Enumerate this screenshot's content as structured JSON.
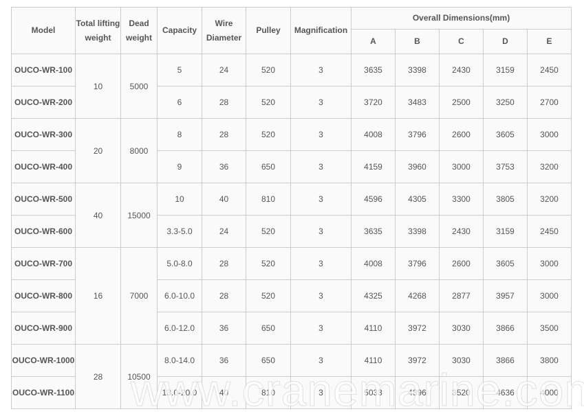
{
  "table": {
    "headers": {
      "model": "Model",
      "total_lifting_weight": "Total lifting weight",
      "dead_weight": "Dead weight",
      "capacity": "Capacity",
      "wire_diameter": "Wire Diameter",
      "pulley": "Pulley",
      "magnification": "Magnification",
      "overall_dimensions": "Overall Dimensions(mm)",
      "dims": [
        "A",
        "B",
        "C",
        "D",
        "E"
      ]
    },
    "groups": [
      {
        "total": "10",
        "dead": "5000"
      },
      {
        "total": "20",
        "dead": "8000"
      },
      {
        "total": "40",
        "dead": "15000"
      },
      {
        "total": "16",
        "dead": "7000"
      },
      {
        "total": "28",
        "dead": "10500"
      }
    ],
    "rows": [
      {
        "model": "OUCO-WR-100",
        "capacity": "5",
        "wire": "24",
        "pulley": "520",
        "mag": "3",
        "a": "3635",
        "b": "3398",
        "c": "2430",
        "d": "3159",
        "e": "2450"
      },
      {
        "model": "OUCO-WR-200",
        "capacity": "6",
        "wire": "28",
        "pulley": "520",
        "mag": "3",
        "a": "3720",
        "b": "3483",
        "c": "2500",
        "d": "3250",
        "e": "2700"
      },
      {
        "model": "OUCO-WR-300",
        "capacity": "8",
        "wire": "28",
        "pulley": "520",
        "mag": "3",
        "a": "4008",
        "b": "3796",
        "c": "2600",
        "d": "3605",
        "e": "3000"
      },
      {
        "model": "OUCO-WR-400",
        "capacity": "9",
        "wire": "36",
        "pulley": "650",
        "mag": "3",
        "a": "4159",
        "b": "3960",
        "c": "3000",
        "d": "3753",
        "e": "3200"
      },
      {
        "model": "OUCO-WR-500",
        "capacity": "10",
        "wire": "40",
        "pulley": "810",
        "mag": "3",
        "a": "4596",
        "b": "4305",
        "c": "3300",
        "d": "3805",
        "e": "3200"
      },
      {
        "model": "OUCO-WR-600",
        "capacity": "3.3-5.0",
        "wire": "24",
        "pulley": "520",
        "mag": "3",
        "a": "3635",
        "b": "3398",
        "c": "2430",
        "d": "3159",
        "e": "2450"
      },
      {
        "model": "OUCO-WR-700",
        "capacity": "5.0-8.0",
        "wire": "28",
        "pulley": "520",
        "mag": "3",
        "a": "4008",
        "b": "3796",
        "c": "2600",
        "d": "3605",
        "e": "3000"
      },
      {
        "model": "OUCO-WR-800",
        "capacity": "6.0-10.0",
        "wire": "28",
        "pulley": "520",
        "mag": "3",
        "a": "4325",
        "b": "4268",
        "c": "2877",
        "d": "3957",
        "e": "3000"
      },
      {
        "model": "OUCO-WR-900",
        "capacity": "6.0-12.0",
        "wire": "36",
        "pulley": "650",
        "mag": "3",
        "a": "4110",
        "b": "3972",
        "c": "3030",
        "d": "3866",
        "e": "3500"
      },
      {
        "model": "OUCO-WR-1000",
        "capacity": "8.0-14.0",
        "wire": "36",
        "pulley": "650",
        "mag": "3",
        "a": "4110",
        "b": "3972",
        "c": "3030",
        "d": "3866",
        "e": "3800"
      },
      {
        "model": "OUCO-WR-1100",
        "capacity": "13.0-20.0",
        "wire": "40",
        "pulley": "810",
        "mag": "3",
        "a": "5033",
        "b": "4896",
        "c": "3520",
        "d": "4636",
        "e": "4000"
      }
    ]
  },
  "watermark": "www.cranemarine.com"
}
